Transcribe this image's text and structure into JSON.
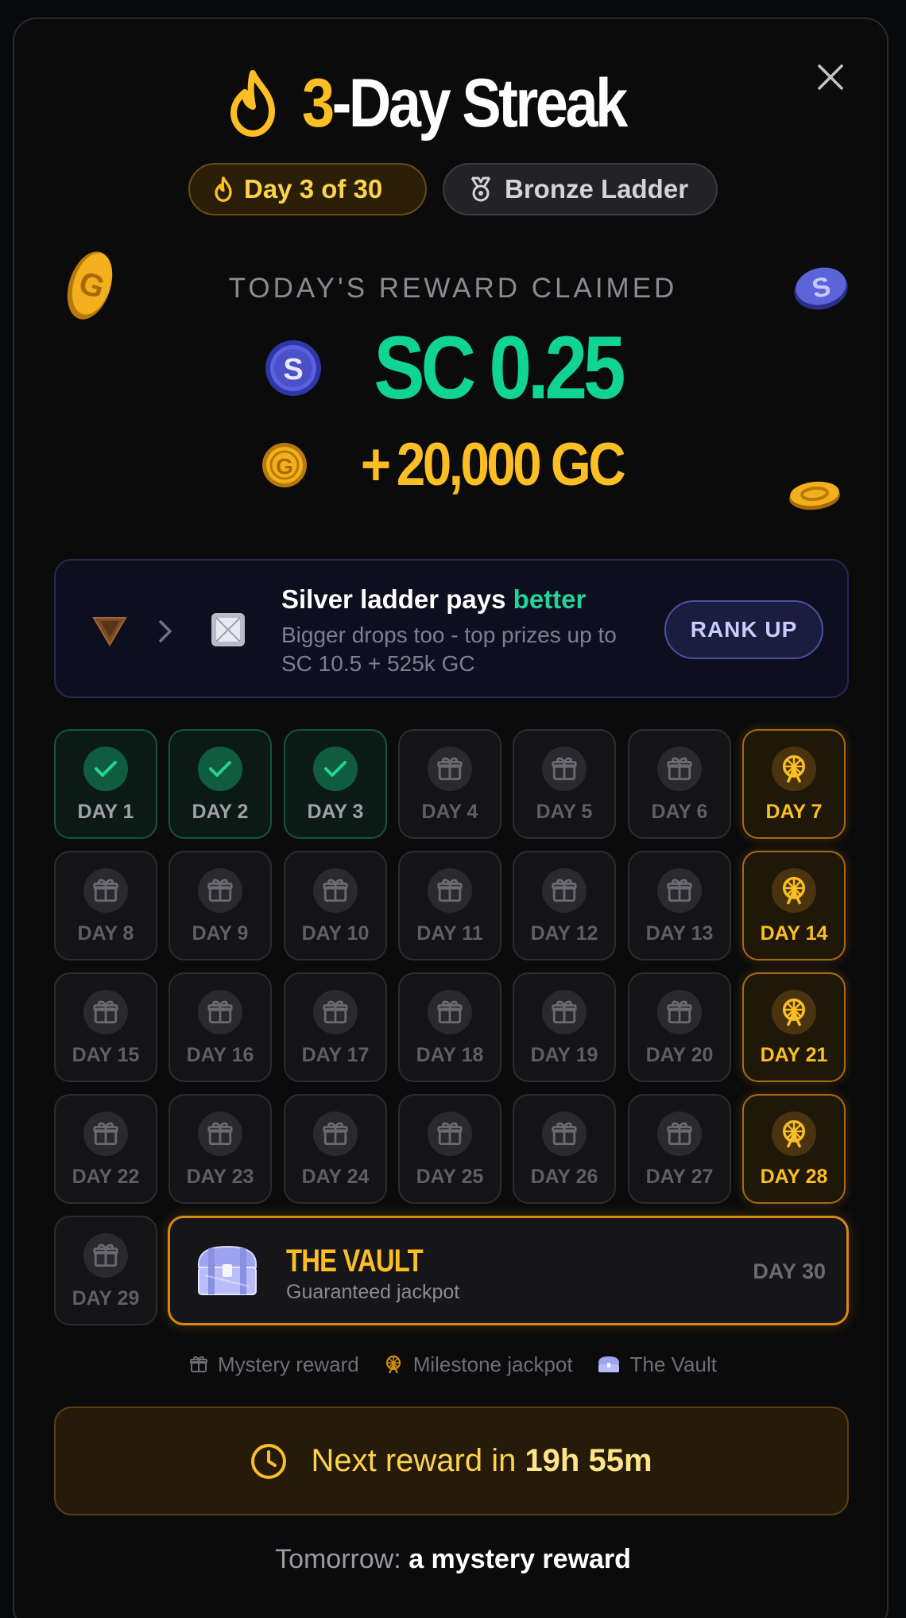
{
  "header": {
    "title_number": "3",
    "title_rest": "-Day Streak",
    "close_label": "close"
  },
  "pills": {
    "progress": "Day 3 of 30",
    "ladder": "Bronze Ladder"
  },
  "today": {
    "label": "TODAY'S REWARD CLAIMED",
    "sc_amount": "SC 0.25",
    "gc_plus": "+",
    "gc_amount": "20,000 GC"
  },
  "promo": {
    "title_prefix": "Silver ladder pays ",
    "title_accent": "better",
    "subtitle": "Bigger drops too - top prizes up to SC 10.5 + 525k GC",
    "button_label": "RANK UP"
  },
  "days": [
    {
      "label": "DAY 1",
      "state": "claimed"
    },
    {
      "label": "DAY 2",
      "state": "claimed"
    },
    {
      "label": "DAY 3",
      "state": "claimed"
    },
    {
      "label": "DAY 4",
      "state": "mystery"
    },
    {
      "label": "DAY 5",
      "state": "mystery"
    },
    {
      "label": "DAY 6",
      "state": "mystery"
    },
    {
      "label": "DAY 7",
      "state": "milestone"
    },
    {
      "label": "DAY 8",
      "state": "mystery"
    },
    {
      "label": "DAY 9",
      "state": "mystery"
    },
    {
      "label": "DAY 10",
      "state": "mystery"
    },
    {
      "label": "DAY 11",
      "state": "mystery"
    },
    {
      "label": "DAY 12",
      "state": "mystery"
    },
    {
      "label": "DAY 13",
      "state": "mystery"
    },
    {
      "label": "DAY 14",
      "state": "milestone"
    },
    {
      "label": "DAY 15",
      "state": "mystery"
    },
    {
      "label": "DAY 16",
      "state": "mystery"
    },
    {
      "label": "DAY 17",
      "state": "mystery"
    },
    {
      "label": "DAY 18",
      "state": "mystery"
    },
    {
      "label": "DAY 19",
      "state": "mystery"
    },
    {
      "label": "DAY 20",
      "state": "mystery"
    },
    {
      "label": "DAY 21",
      "state": "milestone"
    },
    {
      "label": "DAY 22",
      "state": "mystery"
    },
    {
      "label": "DAY 23",
      "state": "mystery"
    },
    {
      "label": "DAY 24",
      "state": "mystery"
    },
    {
      "label": "DAY 25",
      "state": "mystery"
    },
    {
      "label": "DAY 26",
      "state": "mystery"
    },
    {
      "label": "DAY 27",
      "state": "mystery"
    },
    {
      "label": "DAY 28",
      "state": "milestone"
    },
    {
      "label": "DAY 29",
      "state": "mystery"
    }
  ],
  "vault": {
    "title": "THE VAULT",
    "subtitle": "Guaranteed jackpot",
    "day_label": "DAY 30"
  },
  "legend": {
    "mystery": "Mystery reward",
    "milestone": "Milestone jackpot",
    "vault": "The Vault"
  },
  "next_reward": {
    "prefix": "Next reward in ",
    "time": "19h 55m"
  },
  "tomorrow": {
    "prefix": "Tomorrow: ",
    "value": "a mystery reward"
  },
  "colors": {
    "gold": "#fbbf24",
    "green": "#10d494",
    "accent_purple": "#4c50a6",
    "background": "#0b0b0c"
  },
  "icons": {
    "title": "flame-icon",
    "close": "close-icon",
    "claimed": "check-icon",
    "mystery": "gift-icon",
    "milestone": "ferris-wheel-icon",
    "vault": "treasure-chest-icon",
    "timer": "clock-icon"
  }
}
